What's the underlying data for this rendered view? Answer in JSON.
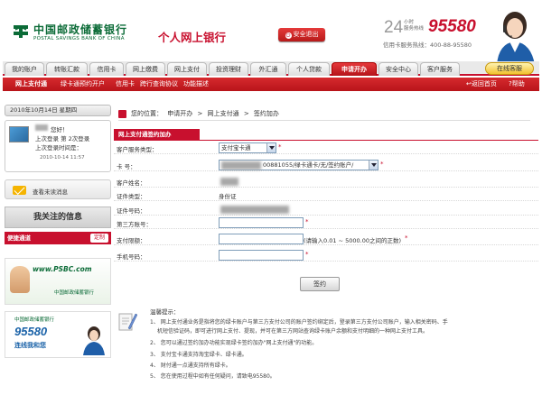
{
  "header": {
    "logo_cn": "中国邮政储蓄银行",
    "logo_en": "POSTAL SAVINGS BANK OF CHINA",
    "banking_title": "个人网上银行",
    "logout_label": "安全退出",
    "hotline_24": "24",
    "hotline_small_1": "小时",
    "hotline_small_2": "服务热线",
    "hotline_number": "95580",
    "hotline_sub": "信用卡服务热线：400-88-95580"
  },
  "nav": {
    "tabs": [
      {
        "label": "我的账户"
      },
      {
        "label": "转账汇款"
      },
      {
        "label": "信用卡"
      },
      {
        "label": "网上缴费"
      },
      {
        "label": "网上支付"
      },
      {
        "label": "投资理财"
      },
      {
        "label": "外汇通"
      },
      {
        "label": "个人贷款"
      },
      {
        "label": "申请开办"
      },
      {
        "label": "安全中心"
      },
      {
        "label": "客户服务"
      }
    ],
    "online_cs": "在线客服"
  },
  "subnav": {
    "items": [
      {
        "label": "网上支付通"
      },
      {
        "label": "绿卡通预约开户"
      },
      {
        "label": "信用卡"
      },
      {
        "label": "跨行查询协议"
      },
      {
        "label": "功能描述"
      }
    ],
    "back_home": "返回首页",
    "help": "帮助"
  },
  "sidebar": {
    "date": "2010年10月14日 星期四",
    "greeting": "您好！",
    "login_info_1": "上次登录 第 2次登录",
    "login_info_2": "上次登录时间是：",
    "last_login_time": "2010-10-14 11:57",
    "messages_label": "查看未读消息",
    "favorites_title": "我关注的信息",
    "quick_label": "便捷通道",
    "quick_custom": "定制",
    "ad1_logo": "www.PSBC.com",
    "ad1_bank": "中国邮政储蓄银行",
    "ad2_bank": "中国邮政储蓄银行",
    "ad2_number": "95580",
    "ad2_slogan": "连线我和您"
  },
  "breadcrumb": {
    "prefix": "您的位置：",
    "items": [
      "申请开办",
      ">",
      "网上支付通",
      ">",
      "签约加办"
    ]
  },
  "form": {
    "title": "网上支付通签约加办",
    "rows": {
      "service_type": {
        "label": "客户服务类型：",
        "value": "支付宝卡通"
      },
      "card_no": {
        "label": "卡  号：",
        "value": "00881055/绿卡通卡/无/签约账户/"
      },
      "customer_name": {
        "label": "客户姓名：",
        "value": ""
      },
      "id_type": {
        "label": "证件类型：",
        "value": "身份证"
      },
      "id_number": {
        "label": "证件号码：",
        "value": ""
      },
      "third_party_acct": {
        "label": "第三方账号：",
        "value": ""
      },
      "payment_limit": {
        "label": "支付限额：",
        "value": "",
        "hint": "(请输入0.01 ~ 5000.00之间的正数)"
      },
      "mobile": {
        "label": "手机号码：",
        "value": ""
      }
    },
    "required_mark": "*",
    "submit_label": "签约"
  },
  "tips": {
    "title": "温馨提示：",
    "items": [
      "1、 网上支付通业务是指将您的绿卡账户与第三方支付公司的账户签约绑定后，登录第三方支付公司账户，输入相关密码、手",
      "机短信验证码，即可进行网上支付、提现，并可在第三方网站查询绿卡账户余额和支付明细的一种网上支付工具。",
      "2、 您可以通过签约加办功能实现绿卡签约加办\"网上支付通\"的功能。",
      "3、 支付宝卡通支持淘宝绿卡、绿卡通。",
      "4、 财付通一点通支持所有绿卡。",
      "5、 您在使用过程中如有任何疑问，请致电95580。"
    ]
  },
  "colors": {
    "brand_red": "#c8102e",
    "brand_green": "#0b6b37",
    "hotline_red": "#c8102e"
  }
}
